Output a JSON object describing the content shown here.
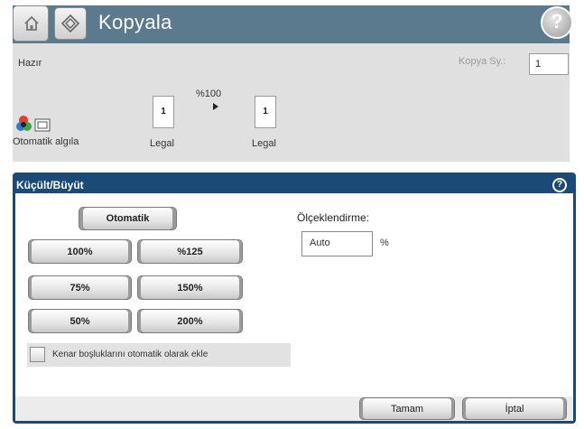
{
  "header": {
    "title": "Kopyala",
    "home_icon": "home-icon",
    "app_icon": "copy-icon",
    "help_icon": "help-icon"
  },
  "status": {
    "state": "Hazır",
    "copies_label": "Kopya Sy.:",
    "copies_value": "1",
    "scale_percent": "%100",
    "source_page_number": "1",
    "source_paper": "Legal",
    "output_page_number": "1",
    "output_paper": "Legal",
    "color_mode_label": "Otomatik algıla"
  },
  "dialog": {
    "title": "Küçült/Büyüt",
    "auto_button": "Otomatik",
    "presets": [
      "100%",
      "%125",
      "75%",
      "150%",
      "50%",
      "200%"
    ],
    "scaling_label": "Ölçeklendirme:",
    "scaling_value": "Auto",
    "scaling_unit": "%",
    "auto_margin_checkbox_label": "Kenar boşluklarını otomatik olarak ekle",
    "auto_margin_checked": false,
    "ok_button": "Tamam",
    "cancel_button": "İptal"
  },
  "colors": {
    "titlebar": "#5b7a8d",
    "dialog_frame": "#1b4a78",
    "status_background": "#e0e0e0"
  }
}
